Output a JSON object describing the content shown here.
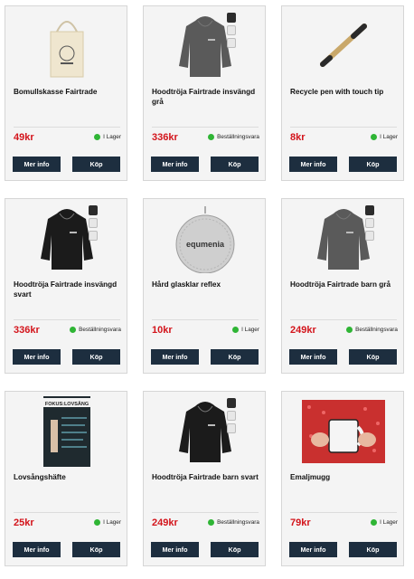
{
  "colors": {
    "price": "#d3141b",
    "button_bg": "#1d2e3f",
    "in_stock_dot": "#2fb535"
  },
  "buttons": {
    "info": "Mer info",
    "buy": "Köp"
  },
  "products": [
    {
      "title": "Bomullskasse Fairtrade",
      "price": "49kr",
      "stock": "I Lager",
      "image": "tote-bag",
      "badges": false
    },
    {
      "title": "Hoodtröja Fairtrade insvängd grå",
      "price": "336kr",
      "stock": "Beställningsvara",
      "image": "hoodie-grey",
      "badges": true
    },
    {
      "title": "Recycle pen with touch tip",
      "price": "8kr",
      "stock": "I Lager",
      "image": "pen",
      "badges": false
    },
    {
      "title": "Hoodtröja Fairtrade insvängd svart",
      "price": "336kr",
      "stock": "Beställningsvara",
      "image": "hoodie-black",
      "badges": true
    },
    {
      "title": "Hård glasklar reflex",
      "price": "10kr",
      "stock": "I Lager",
      "image": "reflector",
      "reflex_text": "equmenia",
      "badges": false
    },
    {
      "title": "Hoodtröja Fairtrade barn grå",
      "price": "249kr",
      "stock": "Beställningsvara",
      "image": "hoodie-grey",
      "badges": true
    },
    {
      "title": "Lovsångshäfte",
      "price": "25kr",
      "stock": "I Lager",
      "image": "songbook",
      "book_text": "FOKUS:LOVSÅNG",
      "badges": false
    },
    {
      "title": "Hoodtröja Fairtrade barn svart",
      "price": "249kr",
      "stock": "Beställningsvara",
      "image": "hoodie-black",
      "badges": true
    },
    {
      "title": "Emaljmugg",
      "price": "79kr",
      "stock": "I Lager",
      "image": "mug",
      "badges": false
    }
  ]
}
